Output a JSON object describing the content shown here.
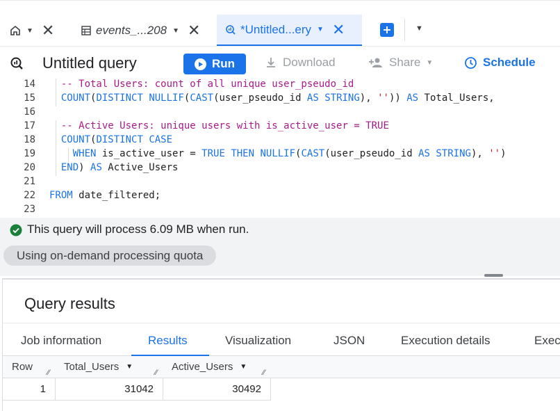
{
  "tabs": [
    {
      "label": "",
      "icon": "home-icon"
    },
    {
      "label": "events_...208",
      "icon": "table-icon"
    },
    {
      "label": "*Untitled...ery",
      "icon": "query-icon",
      "active": true
    }
  ],
  "toolbar": {
    "title": "Untitled query",
    "run_label": "Run",
    "download_label": "Download",
    "share_label": "Share",
    "schedule_label": "Schedule"
  },
  "editor": {
    "lines": [
      {
        "n": "14",
        "text": "  -- Total Users: count of all unique user_pseudo_id"
      },
      {
        "n": "15",
        "text": "  COUNT(DISTINCT NULLIF(CAST(user_pseudo_id AS STRING), '')) AS Total_Users,"
      },
      {
        "n": "16",
        "text": ""
      },
      {
        "n": "17",
        "text": "  -- Active Users: unique users with is_active_user = TRUE"
      },
      {
        "n": "18",
        "text": "  COUNT(DISTINCT CASE"
      },
      {
        "n": "19",
        "text": "    WHEN is_active_user = TRUE THEN NULLIF(CAST(user_pseudo_id AS STRING), '')"
      },
      {
        "n": "20",
        "text": "  END) AS Active_Users"
      },
      {
        "n": "21",
        "text": ""
      },
      {
        "n": "22",
        "text": "FROM date_filtered;"
      },
      {
        "n": "23",
        "text": ""
      }
    ]
  },
  "validation": {
    "message": "This query will process 6.09 MB when run.",
    "quota_label": "Using on-demand processing quota"
  },
  "results": {
    "title": "Query results",
    "tabs": [
      "Job information",
      "Results",
      "Visualization",
      "JSON",
      "Execution details",
      "Exec"
    ],
    "active_tab": "Results",
    "columns": [
      "Row",
      "Total_Users",
      "Active_Users"
    ],
    "rows": [
      {
        "row": "1",
        "total_users": "31042",
        "active_users": "30492"
      }
    ]
  },
  "colors": {
    "accent": "#1a73e8",
    "success": "#188038",
    "comment": "#a81a8a",
    "string": "#c5221f"
  }
}
